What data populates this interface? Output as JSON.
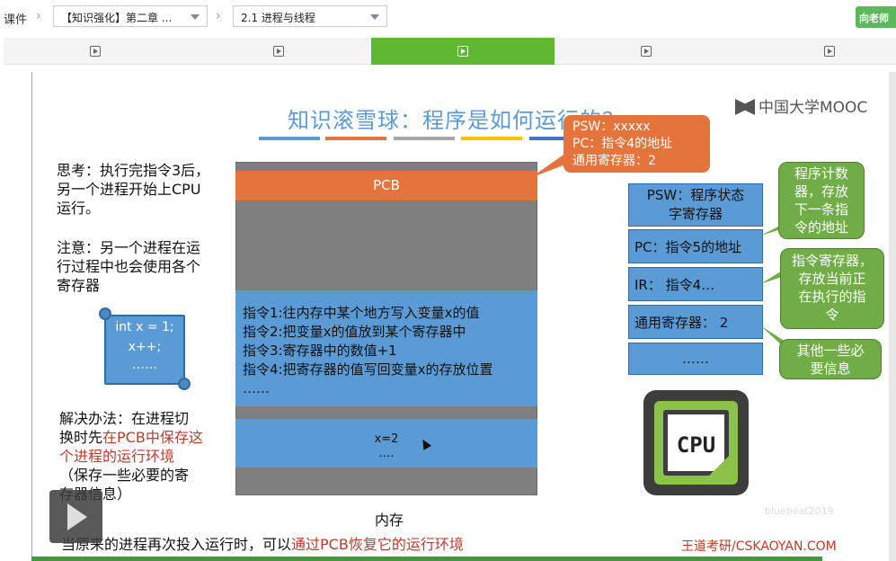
{
  "topbar": {
    "courseware_label": "课件",
    "chapter_select": "【知识强化】第二章 ...",
    "section_select": "2.1 进程与线程",
    "ask_button": "向老师"
  },
  "colors": {
    "accent_green": "#5fb832",
    "slide_blue": "#5b9bd5",
    "pcb_orange": "#e4743b",
    "bubble_green": "#70ad47"
  },
  "tabs": [
    {
      "icon": "play-icon",
      "active": false
    },
    {
      "icon": "play-icon",
      "active": false
    },
    {
      "icon": "play-icon",
      "active": true
    },
    {
      "icon": "play-icon",
      "active": false
    },
    {
      "icon": "play-icon",
      "active": false
    }
  ],
  "slide": {
    "title": "知识滚雪球：程序是如何运行的？",
    "logo": "中国大学MOOC",
    "think": [
      "思考：执行完指令3后，",
      "另一个进程开始上CPU",
      "运行。"
    ],
    "note": [
      "注意：另一个进程在运",
      "行过程中也会使用各个",
      "寄存器"
    ],
    "scroll_code": [
      "int x = 1;",
      "x++;",
      "……"
    ],
    "solution": {
      "line1": "解决办法：在进程切",
      "line2_plain": "换时先",
      "line2_red": "在PCB中保存这",
      "line3_red": "个进程的运行环境",
      "line4": "（保存一些必要的寄",
      "line5": "存器信息）"
    },
    "memory": {
      "pcb": "PCB",
      "instructions": [
        "指令1:往内存中某个地方写入变量x的值",
        "指令2:把变量x的值放到某个寄存器中",
        "指令3:寄存器中的数值+1",
        "指令4:把寄存器的值写回变量x的存放位置",
        "……"
      ],
      "x_value": "x=2",
      "x_more": "….",
      "label": "内存"
    },
    "callout": [
      "PSW：xxxxx",
      "PC：指令4的地址",
      "通用寄存器：2"
    ],
    "registers": {
      "psw": [
        "PSW：程序状态",
        "字寄存器"
      ],
      "pc_label": "PC：",
      "pc_value": "指令5的地址",
      "ir_label": "IR：",
      "ir_value": "指令4…",
      "gen_label": "通用寄存器：",
      "gen_value": "2",
      "more": "……"
    },
    "bubbles": {
      "pc": [
        "程序计数",
        "器，存放",
        "下一条指",
        "令的地址"
      ],
      "ir": [
        "指令寄存器，",
        "存放当前正",
        "在执行的指",
        "令"
      ],
      "other": [
        "其他一些必",
        "要信息"
      ]
    },
    "cpu_label": "CPU",
    "bottom_plain": "当原来的进程再次投入运行时，可以",
    "bottom_red": "通过PCB恢复它的运行环境",
    "watermark": "王道考研/CSKAOYAN.COM",
    "faint_mark": "bluebeat2019"
  }
}
